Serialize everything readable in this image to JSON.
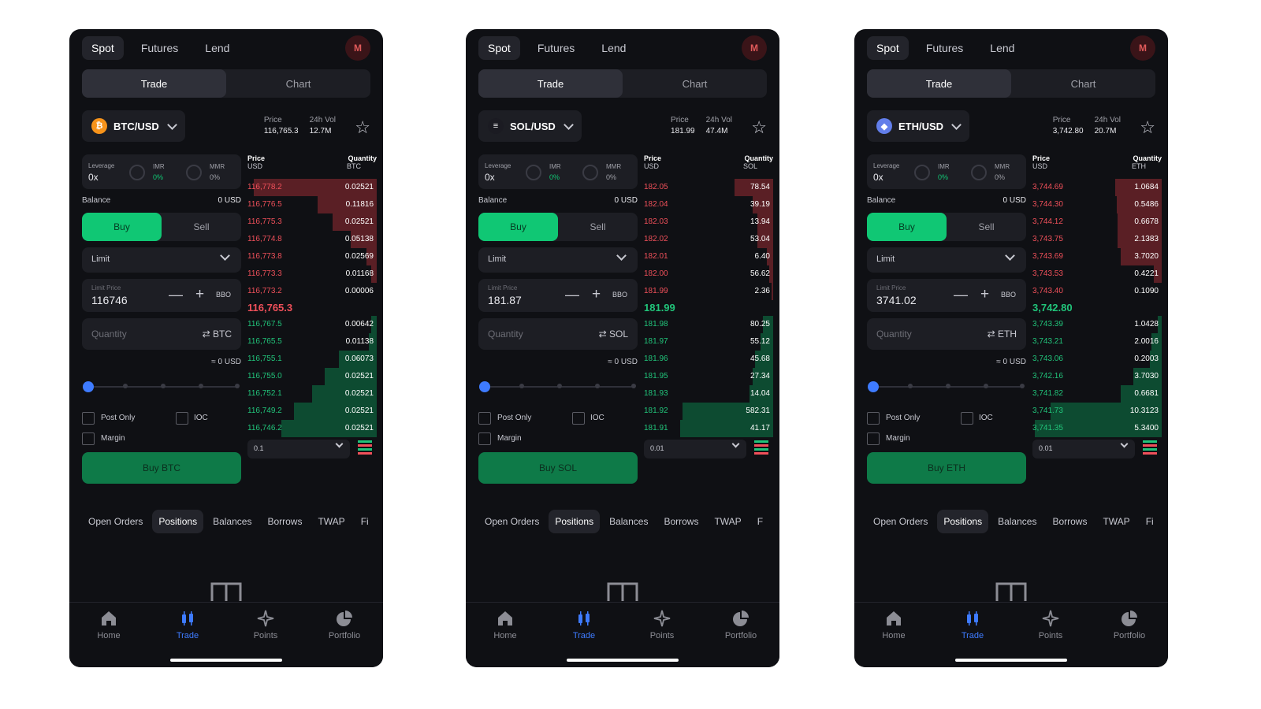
{
  "colors": {
    "bg": "#0f1014",
    "buy": "#10c774",
    "ask": "#f0505a",
    "bid": "#21c47a",
    "accent": "#3e7bff"
  },
  "screens": [
    {
      "top_tabs": [
        "Spot",
        "Futures",
        "Lend"
      ],
      "avatar": "M",
      "segment": [
        "Trade",
        "Chart"
      ],
      "pair": "BTC/USD",
      "coin_glyph": "₿",
      "coin_color": "#f7931a",
      "price_label": "Price",
      "price": "116,765.3",
      "vol_label": "24h Vol",
      "vol": "12.7M",
      "leverage_label": "Leverage",
      "leverage": "0x",
      "imr_label": "IMR",
      "imr": "0%",
      "mmr_label": "MMR",
      "mmr": "0%",
      "balance_label": "Balance",
      "balance": "0 USD",
      "buy": "Buy",
      "sell": "Sell",
      "order_type": "Limit",
      "limit_price_label": "Limit Price",
      "limit_price": "116746",
      "bbo": "BBO",
      "quantity_placeholder": "Quantity",
      "quantity_currency": "⇄ BTC",
      "approx": "≈ 0 USD",
      "post_only": "Post Only",
      "ioc": "IOC",
      "margin": "Margin",
      "buy_button": "Buy BTC",
      "book_price_label": "Price",
      "book_price_unit": "USD",
      "book_qty_label": "Quantity",
      "book_qty_unit": "BTC",
      "asks": [
        {
          "price": "116,778.2",
          "qty": "0.02521",
          "depth": 0.95
        },
        {
          "price": "116,776.5",
          "qty": "0.11816",
          "depth": 0.46
        },
        {
          "price": "116,775.3",
          "qty": "0.02521",
          "depth": 0.34
        },
        {
          "price": "116,774.8",
          "qty": "0.05138",
          "depth": 0.2
        },
        {
          "price": "116,773.8",
          "qty": "0.02569",
          "depth": 0.08
        },
        {
          "price": "116,773.3",
          "qty": "0.01168",
          "depth": 0.04
        },
        {
          "price": "116,773.2",
          "qty": "0.00006",
          "depth": 0.0
        }
      ],
      "mid_price": "116,765.3",
      "mid_color": "#f0505a",
      "bids": [
        {
          "price": "116,767.5",
          "qty": "0.00642",
          "depth": 0.04
        },
        {
          "price": "116,765.5",
          "qty": "0.01138",
          "depth": 0.06
        },
        {
          "price": "116,755.1",
          "qty": "0.06073",
          "depth": 0.29
        },
        {
          "price": "116,755.0",
          "qty": "0.02521",
          "depth": 0.4
        },
        {
          "price": "116,752.1",
          "qty": "0.02521",
          "depth": 0.5
        },
        {
          "price": "116,749.2",
          "qty": "0.02521",
          "depth": 0.64
        },
        {
          "price": "116,746.2",
          "qty": "0.02521",
          "depth": 0.74
        }
      ],
      "tick_size": "0.1",
      "bottom_tabs": [
        "Open Orders",
        "Positions",
        "Balances",
        "Borrows",
        "TWAP",
        "Fi"
      ],
      "nav": [
        "Home",
        "Trade",
        "Points",
        "Portfolio"
      ]
    },
    {
      "top_tabs": [
        "Spot",
        "Futures",
        "Lend"
      ],
      "avatar": "M",
      "segment": [
        "Trade",
        "Chart"
      ],
      "pair": "SOL/USD",
      "coin_glyph": "≡",
      "coin_color": "#1b1b22",
      "price_label": "Price",
      "price": "181.99",
      "vol_label": "24h Vol",
      "vol": "47.4M",
      "leverage_label": "Leverage",
      "leverage": "0x",
      "imr_label": "IMR",
      "imr": "0%",
      "mmr_label": "MMR",
      "mmr": "0%",
      "balance_label": "Balance",
      "balance": "0 USD",
      "buy": "Buy",
      "sell": "Sell",
      "order_type": "Limit",
      "limit_price_label": "Limit Price",
      "limit_price": "181.87",
      "bbo": "BBO",
      "quantity_placeholder": "Quantity",
      "quantity_currency": "⇄ SOL",
      "approx": "≈ 0 USD",
      "post_only": "Post Only",
      "ioc": "IOC",
      "margin": "Margin",
      "buy_button": "Buy SOL",
      "book_price_label": "Price",
      "book_price_unit": "USD",
      "book_qty_label": "Quantity",
      "book_qty_unit": "SOL",
      "asks": [
        {
          "price": "182.05",
          "qty": "78.54",
          "depth": 0.3
        },
        {
          "price": "182.04",
          "qty": "39.19",
          "depth": 0.16
        },
        {
          "price": "182.03",
          "qty": "13.94",
          "depth": 0.12
        },
        {
          "price": "182.02",
          "qty": "53.04",
          "depth": 0.12
        },
        {
          "price": "182.01",
          "qty": "6.40",
          "depth": 0.05
        },
        {
          "price": "182.00",
          "qty": "56.62",
          "depth": 0.03
        },
        {
          "price": "181.99",
          "qty": "2.36",
          "depth": 0.01
        }
      ],
      "mid_price": "181.99",
      "mid_color": "#21c47a",
      "bids": [
        {
          "price": "181.98",
          "qty": "80.25",
          "depth": 0.08
        },
        {
          "price": "181.97",
          "qty": "55.12",
          "depth": 0.1
        },
        {
          "price": "181.96",
          "qty": "45.68",
          "depth": 0.14
        },
        {
          "price": "181.95",
          "qty": "27.34",
          "depth": 0.16
        },
        {
          "price": "181.93",
          "qty": "14.04",
          "depth": 0.18
        },
        {
          "price": "181.92",
          "qty": "582.31",
          "depth": 0.7
        },
        {
          "price": "181.91",
          "qty": "41.17",
          "depth": 0.72
        }
      ],
      "tick_size": "0.01",
      "bottom_tabs": [
        "Open Orders",
        "Positions",
        "Balances",
        "Borrows",
        "TWAP",
        "F"
      ],
      "nav": [
        "Home",
        "Trade",
        "Points",
        "Portfolio"
      ]
    },
    {
      "top_tabs": [
        "Spot",
        "Futures",
        "Lend"
      ],
      "avatar": "M",
      "segment": [
        "Trade",
        "Chart"
      ],
      "pair": "ETH/USD",
      "coin_glyph": "◆",
      "coin_color": "#627eea",
      "price_label": "Price",
      "price": "3,742.80",
      "vol_label": "24h Vol",
      "vol": "20.7M",
      "leverage_label": "Leverage",
      "leverage": "0x",
      "imr_label": "IMR",
      "imr": "0%",
      "mmr_label": "MMR",
      "mmr": "0%",
      "balance_label": "Balance",
      "balance": "0 USD",
      "buy": "Buy",
      "sell": "Sell",
      "order_type": "Limit",
      "limit_price_label": "Limit Price",
      "limit_price": "3741.02",
      "bbo": "BBO",
      "quantity_placeholder": "Quantity",
      "quantity_currency": "⇄ ETH",
      "approx": "≈ 0 USD",
      "post_only": "Post Only",
      "ioc": "IOC",
      "margin": "Margin",
      "buy_button": "Buy ETH",
      "book_price_label": "Price",
      "book_price_unit": "USD",
      "book_qty_label": "Quantity",
      "book_qty_unit": "ETH",
      "asks": [
        {
          "price": "3,744.69",
          "qty": "1.0684",
          "depth": 0.36
        },
        {
          "price": "3,744.30",
          "qty": "0.5486",
          "depth": 0.35
        },
        {
          "price": "3,744.12",
          "qty": "0.6678",
          "depth": 0.34
        },
        {
          "price": "3,743.75",
          "qty": "2.1383",
          "depth": 0.34
        },
        {
          "price": "3,743.69",
          "qty": "3.7020",
          "depth": 0.32
        },
        {
          "price": "3,743.53",
          "qty": "0.4221",
          "depth": 0.06
        },
        {
          "price": "3,743.40",
          "qty": "0.1090",
          "depth": 0.0
        }
      ],
      "mid_price": "3,742.80",
      "mid_color": "#21c47a",
      "bids": [
        {
          "price": "3,743.39",
          "qty": "1.0428",
          "depth": 0.03
        },
        {
          "price": "3,743.21",
          "qty": "2.0016",
          "depth": 0.08
        },
        {
          "price": "3,743.06",
          "qty": "0.2003",
          "depth": 0.09
        },
        {
          "price": "3,742.16",
          "qty": "3.7030",
          "depth": 0.22
        },
        {
          "price": "3,741.82",
          "qty": "0.6681",
          "depth": 0.32
        },
        {
          "price": "3,741.73",
          "qty": "10.3123",
          "depth": 0.86
        },
        {
          "price": "3,741.35",
          "qty": "5.3400",
          "depth": 0.98
        }
      ],
      "tick_size": "0.01",
      "bottom_tabs": [
        "Open Orders",
        "Positions",
        "Balances",
        "Borrows",
        "TWAP",
        "Fi"
      ],
      "nav": [
        "Home",
        "Trade",
        "Points",
        "Portfolio"
      ]
    }
  ]
}
